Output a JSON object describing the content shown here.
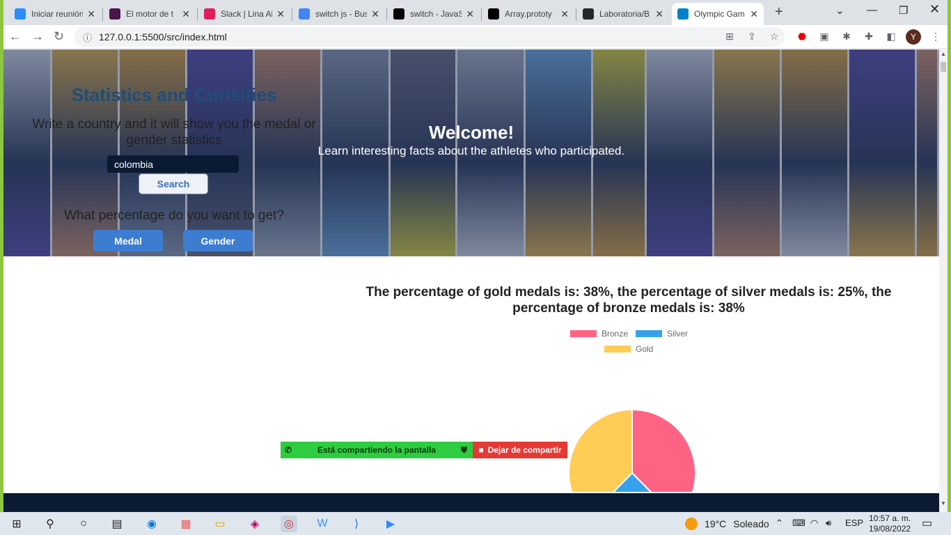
{
  "browser": {
    "tabs": [
      {
        "title": "Iniciar reunión",
        "icon": "zoom-icon",
        "color": "#2d8cff",
        "active": false
      },
      {
        "title": "El motor de t",
        "icon": "slack-icon",
        "color": "#4a154b",
        "active": false
      },
      {
        "title": "Slack | Lina Al",
        "icon": "slack-icon",
        "color": "#e01e5a",
        "active": false
      },
      {
        "title": "switch js - Bus",
        "icon": "google-icon",
        "color": "#4285f4",
        "active": false
      },
      {
        "title": "switch - JavaS",
        "icon": "mdn-icon",
        "color": "#000000",
        "active": false
      },
      {
        "title": "Array.prototy",
        "icon": "mdn-icon",
        "color": "#000000",
        "active": false
      },
      {
        "title": "Laboratoria/B",
        "icon": "github-icon",
        "color": "#24292e",
        "active": false
      },
      {
        "title": "Olympic Gam",
        "icon": "olympic-icon",
        "color": "#0081c8",
        "active": true
      }
    ],
    "url": "127.0.0.1:5500/src/index.html",
    "avatar_letter": "Y"
  },
  "hero": {
    "title": "Welcome!",
    "subtitle": "Learn interesting facts about the athletes who participated."
  },
  "stats": {
    "title": "Statistics and Curisities",
    "prompt": "Write a country and it will show you the medal or gender statistics",
    "country_value": "colombia",
    "search_label": "Search",
    "percentage_question": "What percentage do you want to get?",
    "medal_label": "Medal",
    "gender_label": "Gender"
  },
  "chart_title": "The percentage of gold medals is: 38%, the percentage of silver medals is: 25%, the percentage of bronze medals is: 38%",
  "chart_data": {
    "type": "pie",
    "categories": [
      "Bronze",
      "Silver",
      "Gold"
    ],
    "values": [
      38,
      25,
      38
    ],
    "colors": [
      "#ff6384",
      "#36a2eb",
      "#ffcd56"
    ],
    "legend": "top"
  },
  "sharing": {
    "status": "Está compartiendo la pantalla",
    "stop": "Dejar de compartir"
  },
  "taskbar": {
    "temperature": "19°C",
    "weather": "Soleado",
    "language": "ESP",
    "time": "10:57 a. m.",
    "date": "19/08/2022"
  }
}
